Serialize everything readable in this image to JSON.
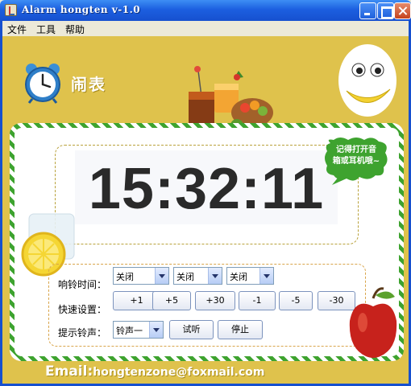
{
  "window": {
    "title": "Alarm hongten v-1.0"
  },
  "menu": [
    "文件",
    "工具",
    "帮助"
  ],
  "header": {
    "title": "闹表"
  },
  "clock": {
    "time": "15:32:11"
  },
  "bubble": {
    "text_line1": "记得打开音",
    "text_line2": "箱或耳机哦~"
  },
  "controls": {
    "ring_time_label": "响铃时间：",
    "ring_time_selects": [
      "关闭",
      "关闭",
      "关闭"
    ],
    "quick_set_label": "快速设置：",
    "quick_set_buttons": [
      "+1",
      "+5",
      "+30",
      "-1",
      "-5",
      "-30"
    ],
    "ringtone_label": "提示铃声：",
    "ringtone_select": "铃声一",
    "audition_button": "试听",
    "stop_button": "停止"
  },
  "footer": {
    "email_label": "Email:",
    "email_address": "hongtenzone@foxmail.com"
  },
  "colors": {
    "panel": "#dfc24c",
    "card_stripe": "#3ea32f",
    "titlebar": "#1c5fe0"
  }
}
